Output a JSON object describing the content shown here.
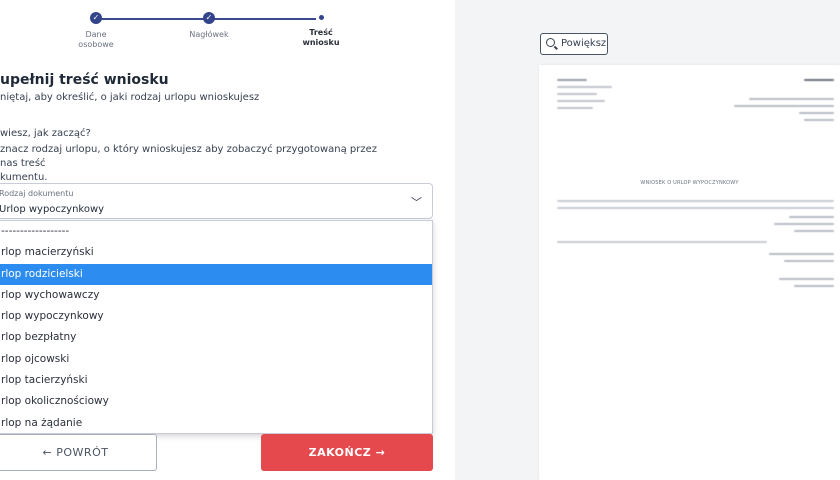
{
  "stepper": {
    "steps": [
      {
        "label_line1": "Dane",
        "label_line2": "osobowe"
      },
      {
        "label_line1": "Nagłówek",
        "label_line2": ""
      },
      {
        "label_line1": "Treść",
        "label_line2": "wniosku"
      }
    ]
  },
  "main": {
    "title": "upełnij treść wniosku",
    "subtitle": "niętaj, aby określić, o jaki rodzaj urlopu wnioskujesz",
    "hint_question": "wiesz, jak zacząć?",
    "hint_line1": "znacz rodzaj urlopu, o który wnioskujesz aby zobaczyć przygotowaną przez nas treść",
    "hint_line2": "kumentu."
  },
  "select": {
    "label": "Rodzaj dokumentu",
    "value": "Urlop wypoczynkowy"
  },
  "dropdown": {
    "options": [
      "------------------",
      "rlop macierzyński",
      "rlop rodzicielski",
      "rlop wychowawczy",
      "rlop wypoczynkowy",
      "rlop bezpłatny",
      "rlop ojcowski",
      "rlop tacierzyński",
      "rlop okolicznościowy",
      "rlop na żądanie"
    ],
    "selected_index": 2
  },
  "buttons": {
    "back": "← POWRÓT",
    "finish": "ZAKOŃCZ →"
  },
  "preview": {
    "zoom_label": "Powiększ",
    "doc_title": "WNIOSEK O URLOP WYPOCZYNKOWY"
  },
  "colors": {
    "accent": "#34448a",
    "selected": "#2d8cf0",
    "finish": "#e5484d"
  }
}
